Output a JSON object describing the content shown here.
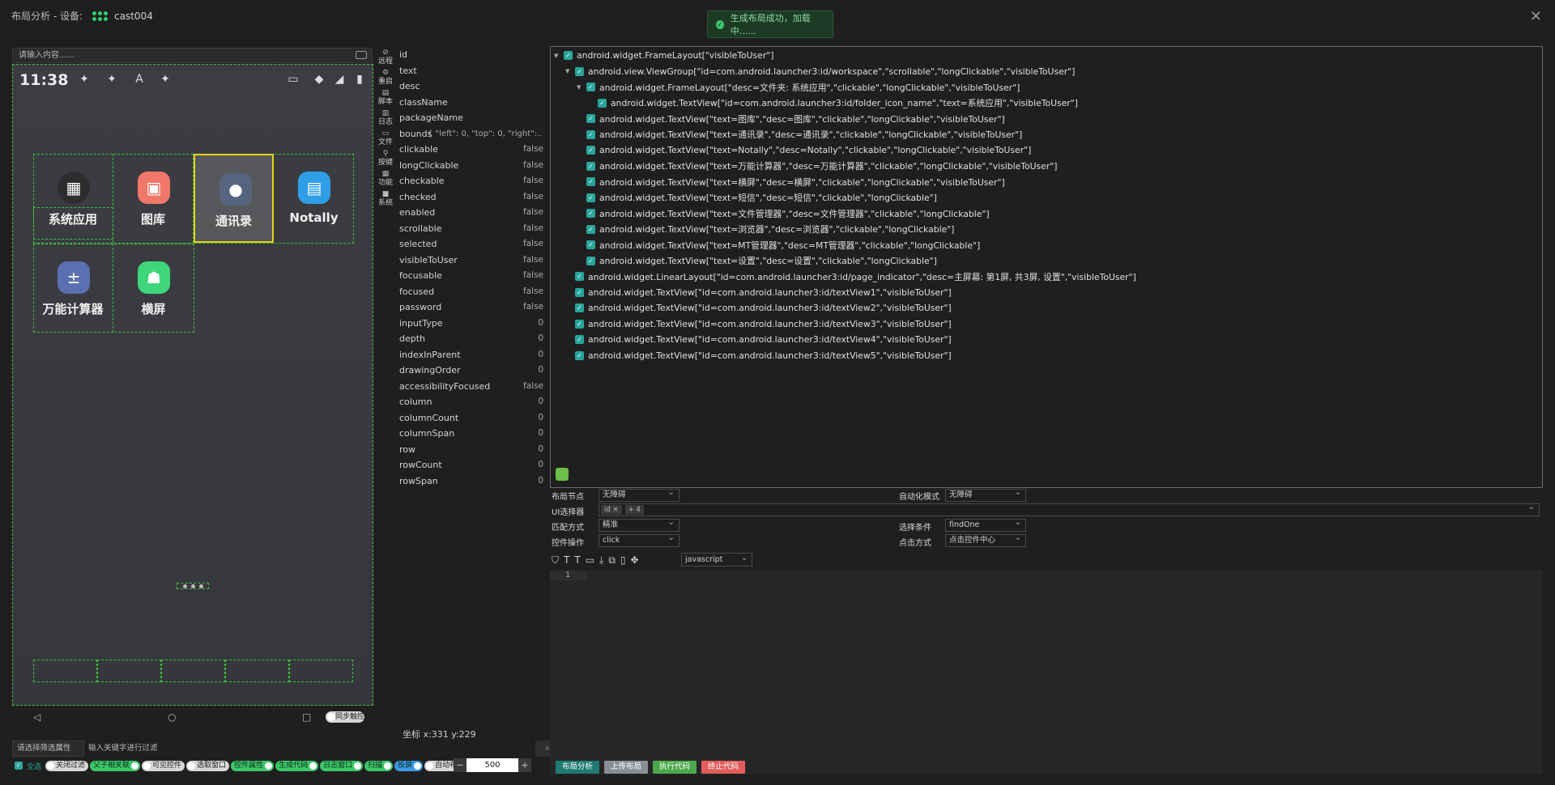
{
  "title": {
    "label": "布局分析 - 设备:",
    "device": "cast004"
  },
  "toast": "生成布局成功，加载中......",
  "phone": {
    "input_placeholder": "请输入内容......",
    "time": "11:38",
    "apps": [
      "系统应用",
      "图库",
      "通讯录",
      "Notally",
      "万能计算器",
      "横屏"
    ],
    "nav_toggle": "同步触控"
  },
  "tools": [
    "远程",
    "重启",
    "脚本",
    "日志",
    "文件",
    "按键",
    "功能",
    "系统"
  ],
  "props": [
    {
      "k": "id",
      "v": ""
    },
    {
      "k": "text",
      "v": ""
    },
    {
      "k": "desc",
      "v": ""
    },
    {
      "k": "className",
      "v": ""
    },
    {
      "k": "packageName",
      "v": ""
    },
    {
      "k": "bounds",
      "v": "{ \"left\": 0, \"top\": 0, \"right\":..."
    },
    {
      "k": "clickable",
      "v": "false"
    },
    {
      "k": "longClickable",
      "v": "false"
    },
    {
      "k": "checkable",
      "v": "false"
    },
    {
      "k": "checked",
      "v": "false"
    },
    {
      "k": "enabled",
      "v": "false"
    },
    {
      "k": "scrollable",
      "v": "false"
    },
    {
      "k": "selected",
      "v": "false"
    },
    {
      "k": "visibleToUser",
      "v": "false"
    },
    {
      "k": "focusable",
      "v": "false"
    },
    {
      "k": "focused",
      "v": "false"
    },
    {
      "k": "password",
      "v": "false"
    },
    {
      "k": "inputType",
      "v": "0"
    },
    {
      "k": "depth",
      "v": "0"
    },
    {
      "k": "indexInParent",
      "v": "0"
    },
    {
      "k": "drawingOrder",
      "v": "0"
    },
    {
      "k": "accessibilityFocused",
      "v": "false"
    },
    {
      "k": "column",
      "v": "0"
    },
    {
      "k": "columnCount",
      "v": "0"
    },
    {
      "k": "columnSpan",
      "v": "0"
    },
    {
      "k": "row",
      "v": "0"
    },
    {
      "k": "rowCount",
      "v": "0"
    },
    {
      "k": "rowSpan",
      "v": "0"
    }
  ],
  "coords": "坐标 x:331 y:229",
  "filter": {
    "select": "请选择筛选属性",
    "input": "输入关键字进行过滤",
    "search_icon": "search-icon"
  },
  "toggles": {
    "select_all": "全选",
    "items": [
      {
        "label": "关闭过滤",
        "on": false
      },
      {
        "label": "父子相关联",
        "on": true
      },
      {
        "label": "可见控件",
        "on": false
      },
      {
        "label": "选取窗口",
        "on": false
      },
      {
        "label": "控件属性",
        "on": true
      },
      {
        "label": "生成代码",
        "on": true
      },
      {
        "label": "日志窗口",
        "on": true
      },
      {
        "label": "扫描",
        "on": true
      },
      {
        "label": "投屏",
        "on": true
      },
      {
        "label": "自动布局分析",
        "on": false
      }
    ]
  },
  "stepper": {
    "minus": "−",
    "value": "500",
    "plus": "+"
  },
  "tree": [
    {
      "depth": 0,
      "arrow": "▼",
      "text": "android.widget.FrameLayout[\"visibleToUser\"]"
    },
    {
      "depth": 1,
      "arrow": "▼",
      "text": "android.view.ViewGroup[\"id=com.android.launcher3:id/workspace\",\"scrollable\",\"longClickable\",\"visibleToUser\"]"
    },
    {
      "depth": 2,
      "arrow": "▼",
      "text": "android.widget.FrameLayout[\"desc=文件夹: 系统应用\",\"clickable\",\"longClickable\",\"visibleToUser\"]"
    },
    {
      "depth": 3,
      "arrow": "",
      "text": "android.widget.TextView[\"id=com.android.launcher3:id/folder_icon_name\",\"text=系统应用\",\"visibleToUser\"]"
    },
    {
      "depth": 2,
      "arrow": "",
      "text": "android.widget.TextView[\"text=图库\",\"desc=图库\",\"clickable\",\"longClickable\",\"visibleToUser\"]"
    },
    {
      "depth": 2,
      "arrow": "",
      "text": "android.widget.TextView[\"text=通讯录\",\"desc=通讯录\",\"clickable\",\"longClickable\",\"visibleToUser\"]"
    },
    {
      "depth": 2,
      "arrow": "",
      "text": "android.widget.TextView[\"text=Notally\",\"desc=Notally\",\"clickable\",\"longClickable\",\"visibleToUser\"]"
    },
    {
      "depth": 2,
      "arrow": "",
      "text": "android.widget.TextView[\"text=万能计算器\",\"desc=万能计算器\",\"clickable\",\"longClickable\",\"visibleToUser\"]"
    },
    {
      "depth": 2,
      "arrow": "",
      "text": "android.widget.TextView[\"text=横屏\",\"desc=横屏\",\"clickable\",\"longClickable\",\"visibleToUser\"]"
    },
    {
      "depth": 2,
      "arrow": "",
      "text": "android.widget.TextView[\"text=短信\",\"desc=短信\",\"clickable\",\"longClickable\"]"
    },
    {
      "depth": 2,
      "arrow": "",
      "text": "android.widget.TextView[\"text=文件管理器\",\"desc=文件管理器\",\"clickable\",\"longClickable\"]"
    },
    {
      "depth": 2,
      "arrow": "",
      "text": "android.widget.TextView[\"text=浏览器\",\"desc=浏览器\",\"clickable\",\"longClickable\"]"
    },
    {
      "depth": 2,
      "arrow": "",
      "text": "android.widget.TextView[\"text=MT管理器\",\"desc=MT管理器\",\"clickable\",\"longClickable\"]"
    },
    {
      "depth": 2,
      "arrow": "",
      "text": "android.widget.TextView[\"text=设置\",\"desc=设置\",\"clickable\",\"longClickable\"]"
    },
    {
      "depth": 1,
      "arrow": "",
      "text": "android.widget.LinearLayout[\"id=com.android.launcher3:id/page_indicator\",\"desc=主屏幕: 第1屏, 共3屏, 设置\",\"visibleToUser\"]"
    },
    {
      "depth": 1,
      "arrow": "",
      "text": "android.widget.TextView[\"id=com.android.launcher3:id/textView1\",\"visibleToUser\"]"
    },
    {
      "depth": 1,
      "arrow": "",
      "text": "android.widget.TextView[\"id=com.android.launcher3:id/textView2\",\"visibleToUser\"]"
    },
    {
      "depth": 1,
      "arrow": "",
      "text": "android.widget.TextView[\"id=com.android.launcher3:id/textView3\",\"visibleToUser\"]"
    },
    {
      "depth": 1,
      "arrow": "",
      "text": "android.widget.TextView[\"id=com.android.launcher3:id/textView4\",\"visibleToUser\"]"
    },
    {
      "depth": 1,
      "arrow": "",
      "text": "android.widget.TextView[\"id=com.android.launcher3:id/textView5\",\"visibleToUser\"]"
    }
  ],
  "form": {
    "layout_node_label": "布局节点",
    "layout_node_value": "无障碍",
    "auto_mode_label": "自动化模式",
    "auto_mode_value": "无障碍",
    "ui_selector_label": "UI选择器",
    "ui_selector_tags": [
      "id ×",
      "+ 4"
    ],
    "match_label": "匹配方式",
    "match_value": "精准",
    "select_cond_label": "选择条件",
    "select_cond_value": "findOne",
    "op_label": "控件操作",
    "op_value": "click",
    "click_label": "点击方式",
    "click_value": "点击控件中心"
  },
  "editor": {
    "lang": "javascript",
    "line": "1"
  },
  "actions": [
    {
      "label": "布局分析",
      "color": "#1f7a74"
    },
    {
      "label": "上传布局",
      "color": "#8a8f96"
    },
    {
      "label": "执行代码",
      "color": "#4aa84a"
    },
    {
      "label": "终止代码",
      "color": "#e25c5c"
    }
  ]
}
